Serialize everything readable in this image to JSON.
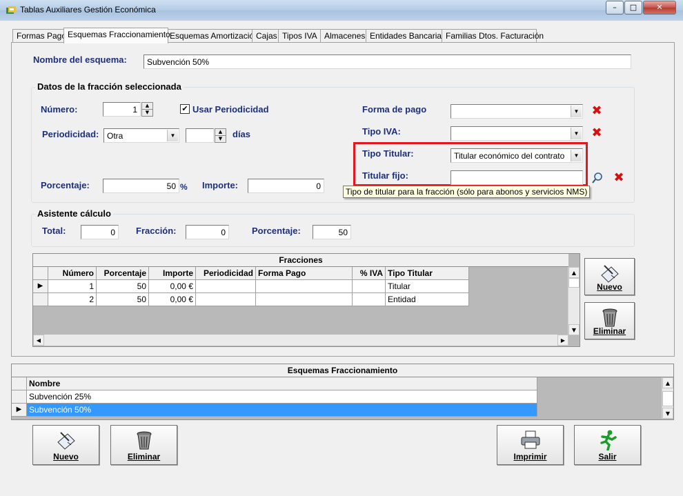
{
  "window": {
    "title": "Tablas Auxiliares Gestión Económica"
  },
  "tabs": [
    "Formas Pago",
    "Esquemas Fraccionamiento",
    "Esquemas Amortización",
    "Cajas",
    "Tipos IVA",
    "Almacenes",
    "Entidades Bancarias",
    "Familias Dtos. Facturación"
  ],
  "scheme": {
    "name_label": "Nombre del esquema:",
    "name_value": "Subvención 50%"
  },
  "fraction": {
    "group_title": "Datos de la fracción seleccionada",
    "numero_label": "Número:",
    "numero_value": "1",
    "usar_periodicidad_label": "Usar Periodicidad",
    "usar_periodicidad_checked": true,
    "periodicidad_label": "Periodicidad:",
    "periodicidad_value": "Otra",
    "dias_value": "",
    "dias_label": "días",
    "porcentaje_label": "Porcentaje:",
    "porcentaje_value": "50",
    "porcentaje_unit": "%",
    "importe_label": "Importe:",
    "importe_value": "0",
    "forma_pago_label": "Forma de pago",
    "forma_pago_value": "",
    "tipo_iva_label": "Tipo IVA:",
    "tipo_iva_value": "",
    "tipo_titular_label": "Tipo Titular:",
    "tipo_titular_value": "Titular económico del contrato",
    "titular_fijo_label": "Titular fijo:",
    "titular_fijo_value": "",
    "tooltip": "Tipo de titular para la fracción (sólo para abonos y servicios NMS)"
  },
  "calc": {
    "group_title": "Asistente cálculo",
    "total_label": "Total:",
    "total_value": "0",
    "fraccion_label": "Fracción:",
    "fraccion_value": "0",
    "porcentaje_label": "Porcentaje:",
    "porcentaje_value": "50"
  },
  "fracciones": {
    "caption": "Fracciones",
    "columns": [
      "Número",
      "Porcentaje",
      "Importe",
      "Periodicidad",
      "Forma Pago",
      "% IVA",
      "Tipo Titular"
    ],
    "rows": [
      {
        "numero": "1",
        "porcentaje": "50",
        "importe": "0,00 €",
        "periodicidad": "",
        "forma_pago": "",
        "iva": "",
        "tipo_titular": "Titular"
      },
      {
        "numero": "2",
        "porcentaje": "50",
        "importe": "0,00 €",
        "periodicidad": "",
        "forma_pago": "",
        "iva": "",
        "tipo_titular": "Entidad"
      }
    ],
    "nuevo_label": "Nuevo",
    "eliminar_label": "Eliminar"
  },
  "esquemas": {
    "caption": "Esquemas Fraccionamiento",
    "column": "Nombre",
    "rows": [
      "Subvención 25%",
      "Subvención 50%"
    ],
    "selected_index": 1
  },
  "buttons": {
    "nuevo": "Nuevo",
    "eliminar": "Eliminar",
    "imprimir": "Imprimir",
    "salir": "Salir"
  },
  "colors": {
    "highlight": "#e3181f",
    "selection": "#3399ff",
    "label": "#1c2f7a"
  }
}
